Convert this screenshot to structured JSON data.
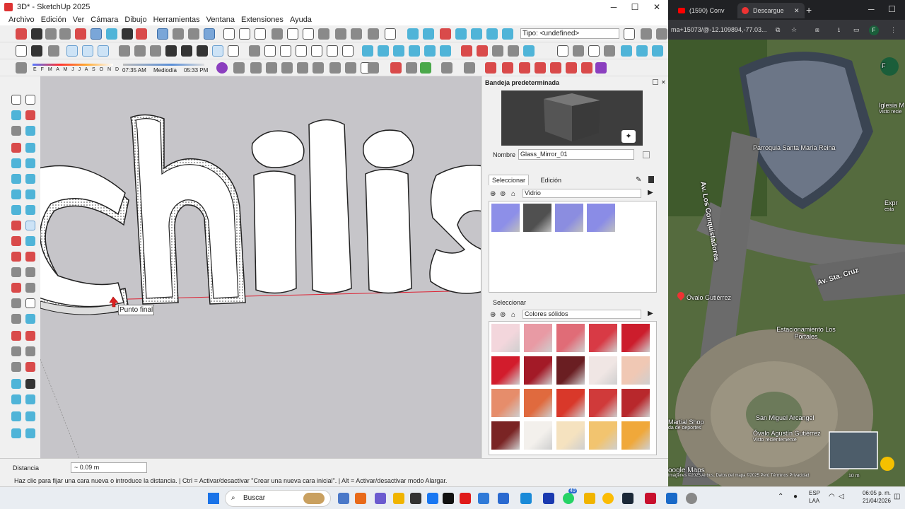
{
  "app": {
    "title": "3D* - SketchUp 2025",
    "menu": [
      "Archivo",
      "Edición",
      "Ver",
      "Cámara",
      "Dibujo",
      "Herramientas",
      "Ventana",
      "Extensiones",
      "Ayuda"
    ],
    "tipo_field": "Tipo: <undefined>",
    "months": "E F M A M J J A S O N D",
    "time_start": "07:35 AM",
    "time_mid": "Mediodía",
    "time_end": "05:33 PM",
    "model_text": "chilis",
    "tooltip": "Punto final"
  },
  "tray": {
    "title": "Bandeja predeterminada",
    "name_label": "Nombre",
    "name_value": "Glass_Mirror_01",
    "tab_select": "Seleccionar",
    "tab_edit": "Edición",
    "library1": "Vidrio",
    "select2": "Seleccionar",
    "library2": "Colores sólidos",
    "glass_colors": [
      "#8d8fe8",
      "#505050",
      "#8b8de0",
      "#8a8ce6"
    ],
    "solid_colors": [
      "#f3d6dc",
      "#e89aa4",
      "#e06c77",
      "#d83a45",
      "#cc1d2c",
      "#d21c2c",
      "#a31a27",
      "#6a1e22",
      "#f0e6e4",
      "#f0c8b4",
      "#e68d6b",
      "#e06a3e",
      "#d9382a",
      "#d03a3a",
      "#b8282c",
      "#7a2424",
      "#f3f0ec",
      "#f5e2bf",
      "#f2c46f",
      "#f0a83a"
    ]
  },
  "statusbar": {
    "distance_label": "Distancia",
    "distance_value": "~ 0.09 m",
    "hint": "Haz clic para fijar una cara nueva o introduce la distancia. | Ctrl = Activar/desactivar \"Crear una nueva cara inicial\". | Alt = Activar/desactivar modo Alargar."
  },
  "browser": {
    "tab1": "(1590) Conv",
    "tab2": "Descargue",
    "address": "ma+15073/@-12.109894,-77.03...",
    "profile": "F",
    "labels": {
      "iglesia": "Iglesia M",
      "iglesia_sub": "Visto recie",
      "parroquia": "Parroquia Santa María Reina",
      "street1": "Av. Los Conquistadores",
      "street2": "Av. Sta. Cruz",
      "ovalo": "Óvalo Gutiérrez",
      "estacionamiento": "Estacionamiento Los Portales",
      "miguel": "San Miguel Arcangel",
      "martial": "Martial Shop",
      "martial_sub": "da de deportes",
      "ovalo2": "Óvalo Agustín Gutiérrez",
      "ovalo2_sub": "Visto recientemente",
      "expr": "Expr",
      "expr_sub": "esta",
      "google": "oogle Maps",
      "footer": "Imágenes ©2025 Airbus, Datos del mapa ©2025   Perú   Términos   Privacidad",
      "scale": "10 m"
    }
  },
  "taskbar": {
    "search": "Buscar",
    "lang1": "ESP",
    "lang2": "LAA",
    "time": "06:05 p. m.",
    "date": "21/04/2026",
    "badge": "40"
  }
}
